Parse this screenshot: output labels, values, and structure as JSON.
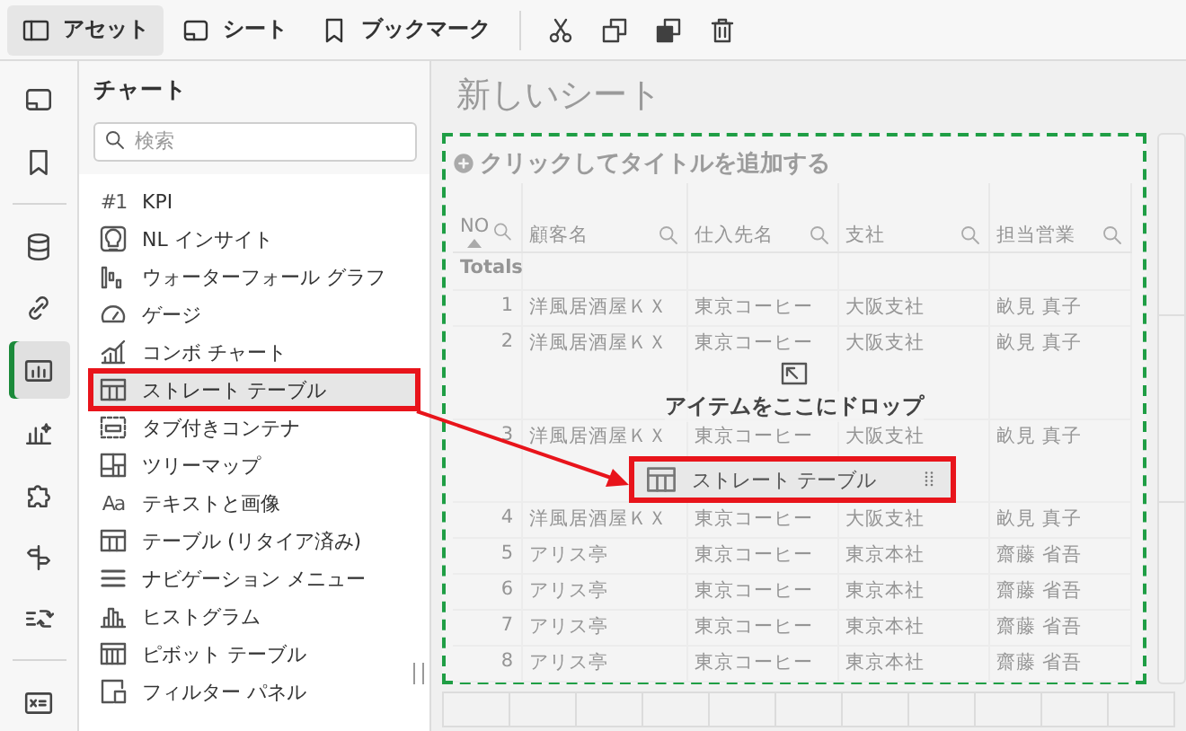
{
  "toolbar": {
    "tabs": [
      {
        "kind": "panel",
        "label": "アセット",
        "selected": true
      },
      {
        "kind": "sheet",
        "label": "シート",
        "selected": false
      },
      {
        "kind": "bookmark",
        "label": "ブックマーク",
        "selected": false
      }
    ],
    "actions": [
      {
        "kind": "scissors"
      },
      {
        "kind": "copy"
      },
      {
        "kind": "duplicate"
      },
      {
        "kind": "trash"
      }
    ]
  },
  "rail": {
    "items": [
      {
        "kind": "sheet",
        "selected": false
      },
      {
        "kind": "bookmark",
        "selected": false
      },
      {
        "kind": "divider"
      },
      {
        "kind": "database",
        "selected": false
      },
      {
        "kind": "link",
        "selected": false
      },
      {
        "kind": "chart",
        "selected": true
      },
      {
        "kind": "sparkle",
        "selected": false
      },
      {
        "kind": "puzzle",
        "selected": false
      },
      {
        "kind": "signpost",
        "selected": false
      },
      {
        "kind": "automation",
        "selected": false
      },
      {
        "kind": "divider"
      },
      {
        "kind": "variable",
        "selected": false
      }
    ]
  },
  "panel": {
    "title": "チャート",
    "search": {
      "placeholder": "検索"
    },
    "items": [
      {
        "kind": "glyph",
        "glyph": "#1",
        "label": "KPI",
        "selected": false
      },
      {
        "kind": "bulb",
        "label": "NL インサイト",
        "selected": false
      },
      {
        "kind": "waterfall",
        "label": "ウォーターフォール グラフ",
        "selected": false
      },
      {
        "kind": "gauge",
        "label": "ゲージ",
        "selected": false
      },
      {
        "kind": "combo",
        "label": "コンボ チャート",
        "selected": false
      },
      {
        "kind": "table",
        "label": "ストレート テーブル",
        "selected": true
      },
      {
        "kind": "tabs",
        "label": "タブ付きコンテナ",
        "selected": false
      },
      {
        "kind": "treemap",
        "label": "ツリーマップ",
        "selected": false
      },
      {
        "kind": "glyph",
        "glyph": "Aa",
        "label": "テキストと画像",
        "selected": false
      },
      {
        "kind": "table",
        "label": "テーブル (リタイア済み)",
        "selected": false
      },
      {
        "kind": "menu",
        "label": "ナビゲーション メニュー",
        "selected": false
      },
      {
        "kind": "histogram",
        "label": "ヒストグラム",
        "selected": false
      },
      {
        "kind": "pivot",
        "label": "ピボット テーブル",
        "selected": false
      },
      {
        "kind": "filter",
        "label": "フィルター パネル",
        "selected": false
      }
    ]
  },
  "sheet": {
    "title": "新しいシート",
    "table": {
      "title": "クリックしてタイトルを追加する",
      "totals_label": "Totals",
      "columns": [
        {
          "label": "NO",
          "sorted": true
        },
        {
          "label": "顧客名",
          "sorted": false
        },
        {
          "label": "仕入先名",
          "sorted": false
        },
        {
          "label": "支社",
          "sorted": false
        },
        {
          "label": "担当営業",
          "sorted": false
        }
      ],
      "rows": [
        [
          "1",
          "洋風居酒屋ＫＸ",
          "東京コーヒー",
          "大阪支社",
          "畝見 真子"
        ],
        [
          "2",
          "洋風居酒屋ＫＸ",
          "東京コーヒー",
          "大阪支社",
          "畝見 真子"
        ],
        [
          "3",
          "洋風居酒屋ＫＸ",
          "東京コーヒー",
          "大阪支社",
          "畝見 真子"
        ],
        [
          "4",
          "洋風居酒屋ＫＸ",
          "東京コーヒー",
          "大阪支社",
          "畝見 真子"
        ],
        [
          "5",
          "アリス亭",
          "東京コーヒー",
          "東京本社",
          "齋藤 省吾"
        ],
        [
          "6",
          "アリス亭",
          "東京コーヒー",
          "東京本社",
          "齋藤 省吾"
        ],
        [
          "7",
          "アリス亭",
          "東京コーヒー",
          "東京本社",
          "齋藤 省吾"
        ],
        [
          "8",
          "アリス亭",
          "東京コーヒー",
          "東京本社",
          "齋藤 省吾"
        ]
      ]
    },
    "drop_zone": {
      "label": "アイテムをここにドロップ"
    },
    "drag_item": {
      "kind": "table",
      "label": "ストレート テーブル"
    }
  }
}
